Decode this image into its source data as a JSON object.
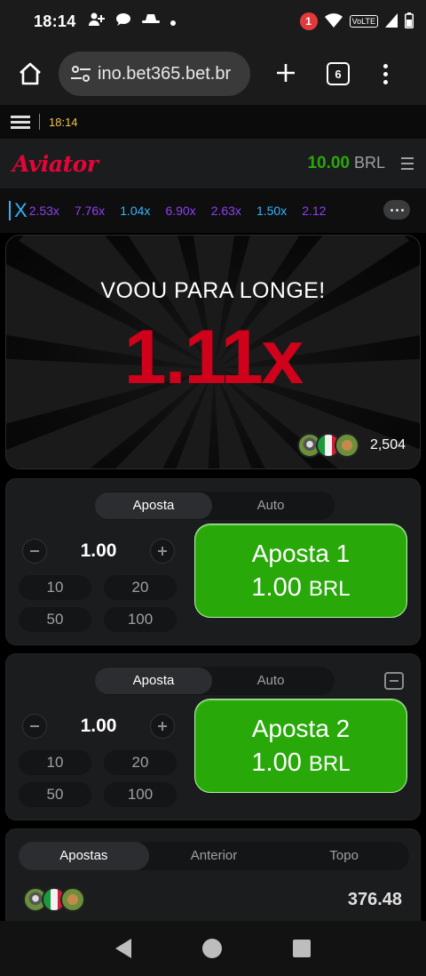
{
  "status_bar": {
    "time": "18:14",
    "notification_count": "1",
    "network_badge": "VoLTE"
  },
  "browser": {
    "url": "ino.bet365.bet.br",
    "tab_count": "6"
  },
  "site_strip": {
    "time": "18:14"
  },
  "game": {
    "logo": "Aviator",
    "balance_amount": "10.00",
    "balance_currency": "BRL",
    "history": [
      "2.53x",
      "7.76x",
      "1.04x",
      "6.90x",
      "2.63x",
      "1.50x",
      "2.12"
    ],
    "history_colors": [
      "#913ef8",
      "#913ef8",
      "#34b4ff",
      "#913ef8",
      "#913ef8",
      "#34b4ff",
      "#913ef8"
    ],
    "status_text": "VOOU PARA LONGE!",
    "multiplier": "1.11x",
    "players_count": "2,504"
  },
  "bet_panels": [
    {
      "tabs": [
        "Aposta",
        "Auto"
      ],
      "stake": "1.00",
      "quick_amounts": [
        "10",
        "20",
        "50",
        "100"
      ],
      "button_title": "Aposta 1",
      "button_amount": "1.00",
      "button_currency": "BRL"
    },
    {
      "tabs": [
        "Aposta",
        "Auto"
      ],
      "stake": "1.00",
      "quick_amounts": [
        "10",
        "20",
        "50",
        "100"
      ],
      "button_title": "Aposta 2",
      "button_amount": "1.00",
      "button_currency": "BRL"
    }
  ],
  "bets_list": {
    "tabs": [
      "Apostas",
      "Anterior",
      "Topo"
    ],
    "total": "376.48"
  },
  "colors": {
    "accent_green": "#28a909",
    "brand_red": "#e50539",
    "crash_red": "#d0021b"
  }
}
